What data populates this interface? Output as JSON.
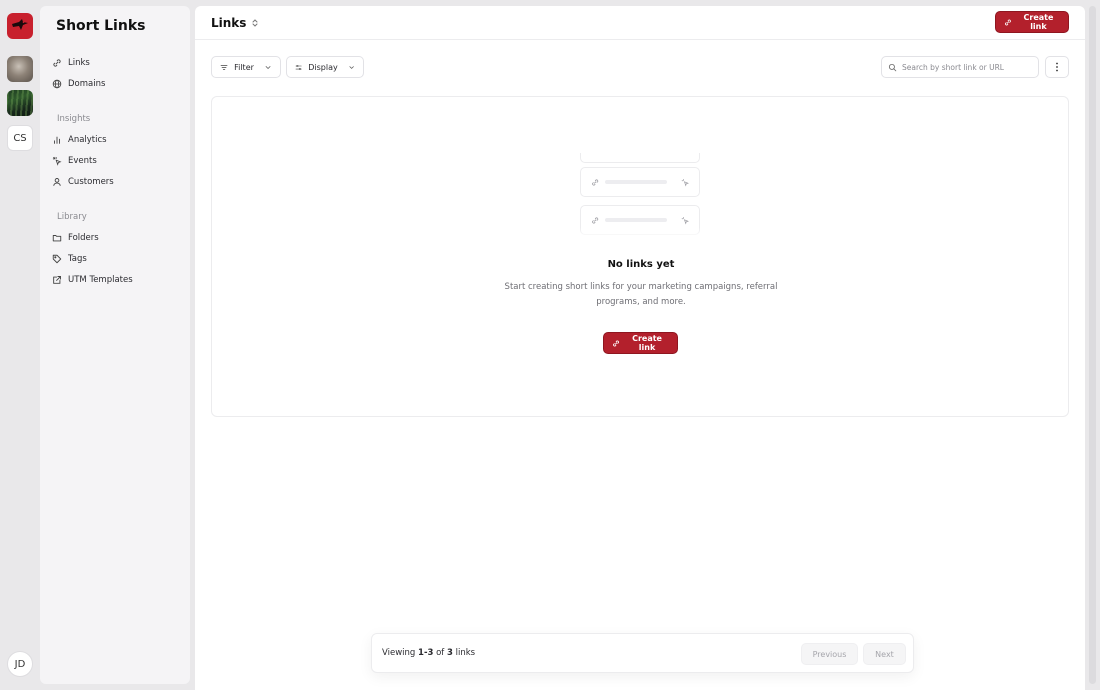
{
  "rail": {
    "workspaces": [
      {
        "name": "logo-workspace",
        "icon": "bird-logo-icon",
        "color": "#c8202d"
      },
      {
        "name": "photo-workspace-1"
      },
      {
        "name": "photo-workspace-2"
      },
      {
        "name": "cs-workspace",
        "initials": "CS"
      }
    ],
    "user_initials": "JD"
  },
  "sidebar": {
    "title": "Short Links",
    "items": [
      {
        "label": "Links",
        "icon": "link-icon"
      },
      {
        "label": "Domains",
        "icon": "globe-icon"
      }
    ],
    "insights": {
      "heading": "Insights",
      "items": [
        {
          "label": "Analytics",
          "icon": "bar-chart-icon"
        },
        {
          "label": "Events",
          "icon": "cursor-rays-icon"
        },
        {
          "label": "Customers",
          "icon": "user-icon"
        }
      ]
    },
    "library": {
      "heading": "Library",
      "items": [
        {
          "label": "Folders",
          "icon": "folder-icon"
        },
        {
          "label": "Tags",
          "icon": "tag-icon"
        },
        {
          "label": "UTM Templates",
          "icon": "external-link-icon"
        }
      ]
    }
  },
  "header": {
    "title": "Links",
    "create_label": "Create link"
  },
  "toolbar": {
    "filter_label": "Filter",
    "display_label": "Display",
    "search_placeholder": "Search by short link or URL"
  },
  "empty_state": {
    "title": "No links yet",
    "description": "Start creating short links for your marketing campaigns, referral programs, and more.",
    "create_label": "Create link"
  },
  "pagination": {
    "prefix": "Viewing",
    "range": "1-3",
    "of": "of",
    "total": "3",
    "suffix": "links",
    "previous_label": "Previous",
    "next_label": "Next"
  },
  "colors": {
    "accent": "#b3202c",
    "sidebar_bg": "#f5f4f6"
  }
}
